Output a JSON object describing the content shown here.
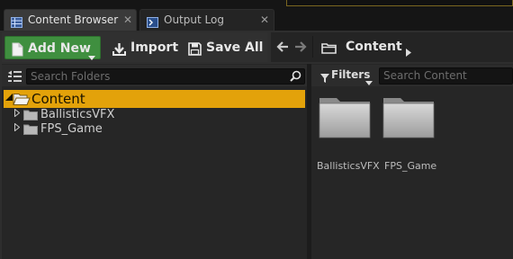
{
  "tabs": [
    {
      "label": "Content Browser",
      "icon": "content-browser-icon",
      "active": true
    },
    {
      "label": "Output Log",
      "icon": "output-log-icon",
      "active": false
    }
  ],
  "toolbar": {
    "add_new_label": "Add New",
    "import_label": "Import",
    "save_all_label": "Save All"
  },
  "breadcrumb": {
    "current": "Content"
  },
  "folders": {
    "search_placeholder": "Search Folders",
    "root": "Content",
    "children": [
      {
        "label": "BallisticsVFX"
      },
      {
        "label": "FPS_Game"
      }
    ]
  },
  "content": {
    "filters_label": "Filters",
    "search_placeholder": "Search Content",
    "items": [
      {
        "label": "BallisticsVFX",
        "type": "folder"
      },
      {
        "label": "FPS_Game",
        "type": "folder"
      }
    ]
  },
  "colors": {
    "accent_green": "#3f8f3f",
    "selection_gold": "#e3a20a",
    "panel_dark": "#262626"
  }
}
